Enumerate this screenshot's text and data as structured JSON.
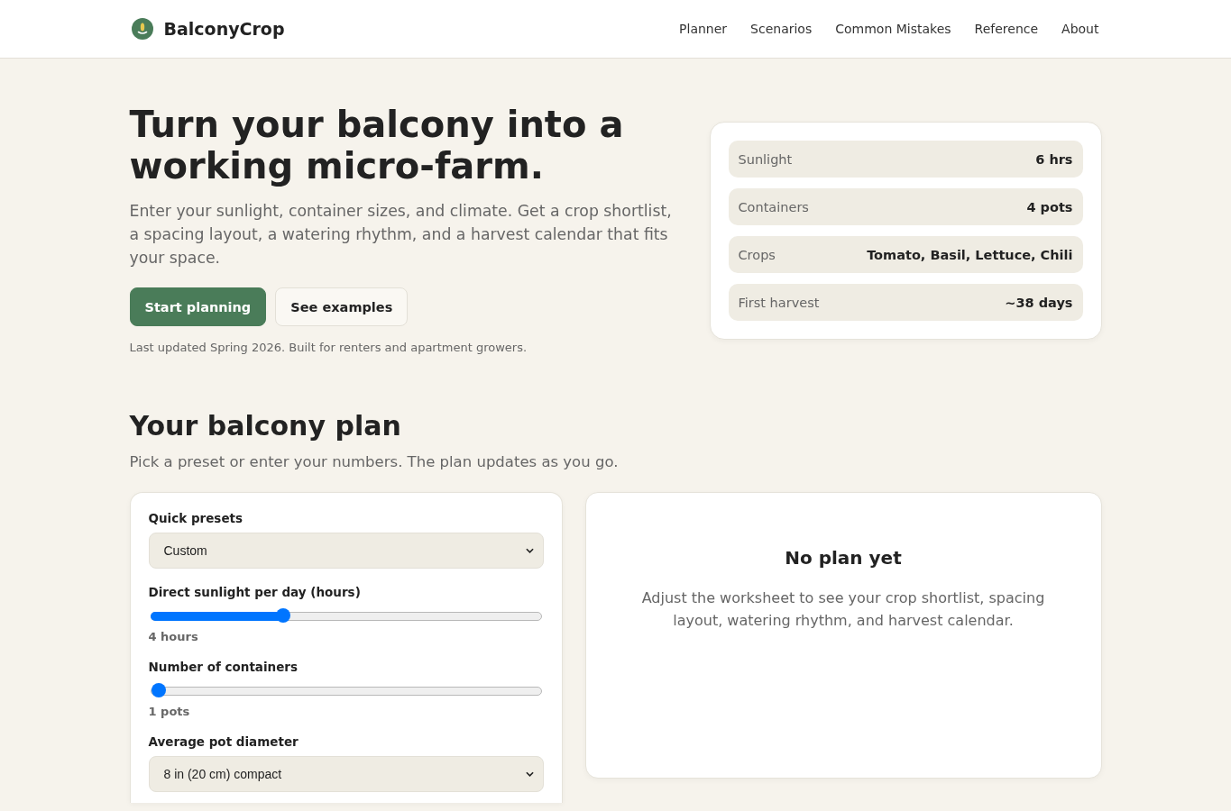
{
  "header": {
    "brand": "BalconyCrop",
    "nav": [
      "Planner",
      "Scenarios",
      "Common Mistakes",
      "Reference",
      "About"
    ]
  },
  "hero": {
    "title": "Turn your balcony into a working micro-farm.",
    "intro": "Enter your sunlight, container sizes, and climate. Get a crop shortlist, a spacing layout, a watering rhythm, and a harvest calendar that fits your space.",
    "buttons": [
      {
        "label": "Start planning",
        "kind": "primary"
      },
      {
        "label": "See examples",
        "kind": "secondary"
      }
    ],
    "note": "Last updated Spring 2026. Built for renters and apartment growers."
  },
  "summary_card": {
    "rows": [
      {
        "label": "Sunlight",
        "value": "6 hrs"
      },
      {
        "label": "Containers",
        "value": "4 pots"
      },
      {
        "label": "Crops",
        "value": "Tomato, Basil, Lettuce, Chili"
      },
      {
        "label": "First harvest",
        "value": "~38 days"
      }
    ]
  },
  "plan": {
    "title": "Your balcony plan",
    "subtitle": "Pick a preset or enter your numbers. The plan updates as you go.",
    "worksheet": {
      "fields": [
        {
          "kind": "select",
          "label": "Quick presets",
          "value": "Custom"
        },
        {
          "kind": "slider",
          "label": "Direct sunlight per day (hours)",
          "level": 0.333,
          "reading": "4 hours"
        },
        {
          "kind": "slider",
          "label": "Number of containers",
          "level": 0,
          "reading": "1 pots"
        },
        {
          "kind": "select",
          "label": "Average pot diameter",
          "value": "8 in (20 cm) compact"
        }
      ]
    },
    "result": {
      "title": "No plan yet",
      "text": "Adjust the worksheet to see your crop shortlist, spacing layout, watering rhythm, and harvest calendar."
    }
  }
}
